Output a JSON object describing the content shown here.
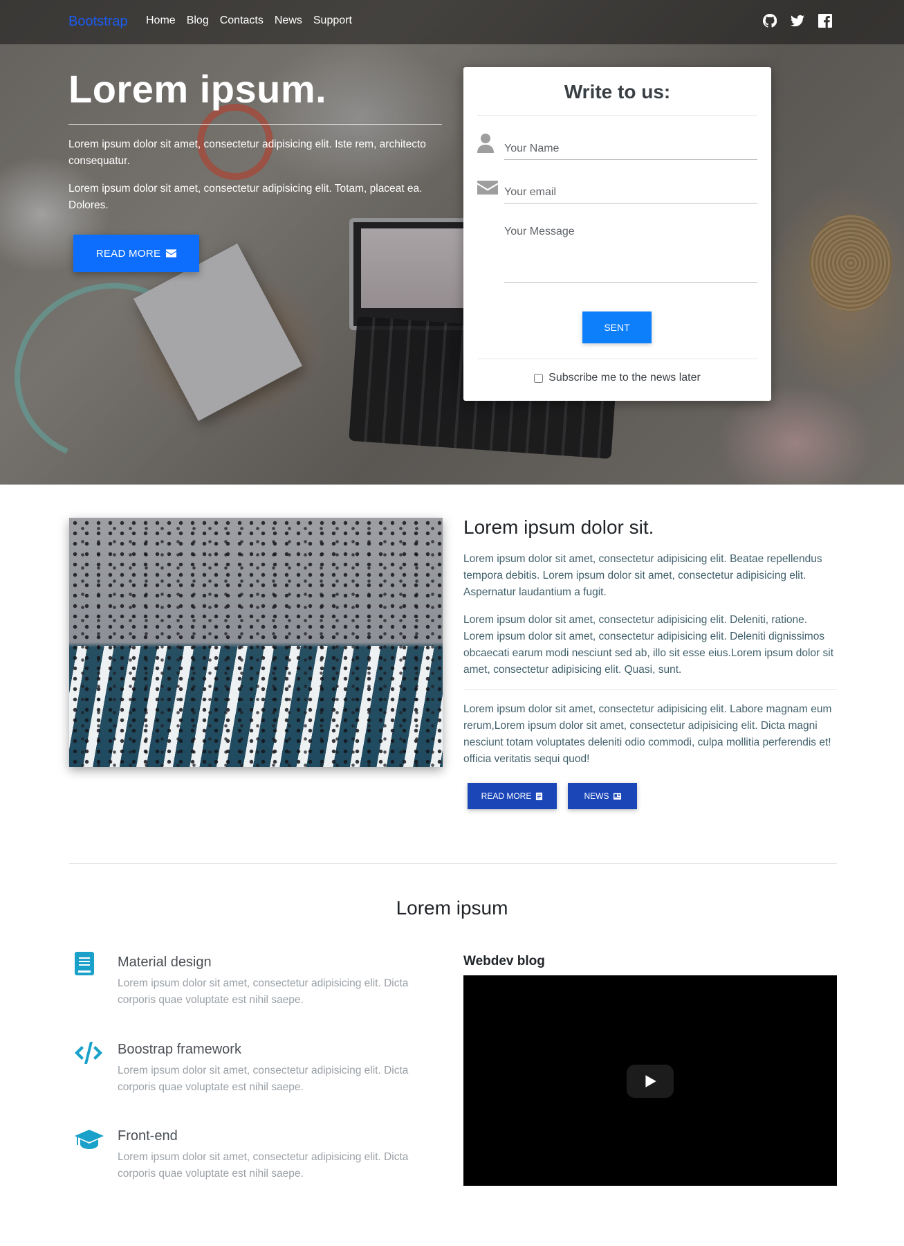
{
  "nav": {
    "brand": "Bootstrap",
    "links": [
      "Home",
      "Blog",
      "Contacts",
      "News",
      "Support"
    ],
    "social_icons": [
      "github-icon",
      "twitter-icon",
      "facebook-icon"
    ]
  },
  "hero": {
    "title": "Lorem ipsum.",
    "paragraph1": "Lorem ipsum dolor sit amet, consectetur adipisicing elit. Iste rem, architecto consequatur.",
    "paragraph2": "Lorem ipsum dolor sit amet, consectetur adipisicing elit. Totam, placeat ea. Dolores.",
    "button_label": "READ MORE",
    "button_icon": "envelope-icon"
  },
  "contact_form": {
    "title": "Write to us:",
    "name_placeholder": "Your Name",
    "email_placeholder": "Your email",
    "message_placeholder": "Your Message",
    "submit_label": "SENT",
    "subscribe_label": "Subscribe me to the news later",
    "subscribe_checked": false,
    "icons": [
      "user-icon",
      "envelope-icon"
    ]
  },
  "about": {
    "title": "Lorem ipsum dolor sit.",
    "paragraph1": "Lorem ipsum dolor sit amet, consectetur adipisicing elit. Beatae repellendus tempora debitis. Lorem ipsum dolor sit amet, consectetur adipisicing elit. Aspernatur laudantium a fugit.",
    "paragraph2": "Lorem ipsum dolor sit amet, consectetur adipisicing elit. Deleniti, ratione. Lorem ipsum dolor sit amet, consectetur adipisicing elit. Deleniti dignissimos obcaecati earum modi nesciunt sed ab, illo sit esse eius.Lorem ipsum dolor sit amet, consectetur adipisicing elit. Quasi, sunt.",
    "paragraph3": "Lorem ipsum dolor sit amet, consectetur adipisicing elit. Labore magnam eum rerum,Lorem ipsum dolor sit amet, consectetur adipisicing elit. Dicta magni nesciunt totam voluptates deleniti odio commodi, culpa mollitia perferendis et! officia veritatis sequi quod!",
    "read_more_label": "READ MORE",
    "news_label": "NEWS"
  },
  "features": {
    "section_title": "Lorem ipsum",
    "items": [
      {
        "title": "Material design",
        "text": "Lorem ipsum dolor sit amet, consectetur adipisicing elit. Dicta corporis quae voluptate est nihil saepe.",
        "icon": "book-icon"
      },
      {
        "title": "Boostrap framework",
        "text": "Lorem ipsum dolor sit amet, consectetur adipisicing elit. Dicta corporis quae voluptate est nihil saepe.",
        "icon": "code-icon"
      },
      {
        "title": "Front-end",
        "text": "Lorem ipsum dolor sit amet, consectetur adipisicing elit. Dicta corporis quae voluptate est nihil saepe.",
        "icon": "graduation-cap-icon"
      }
    ]
  },
  "video": {
    "title": "Webdev blog"
  },
  "colors": {
    "primary": "#0d6efd",
    "dark_button": "#1a46b8",
    "feature_icon": "#1aa1c9",
    "brand": "#1a5cf2"
  }
}
